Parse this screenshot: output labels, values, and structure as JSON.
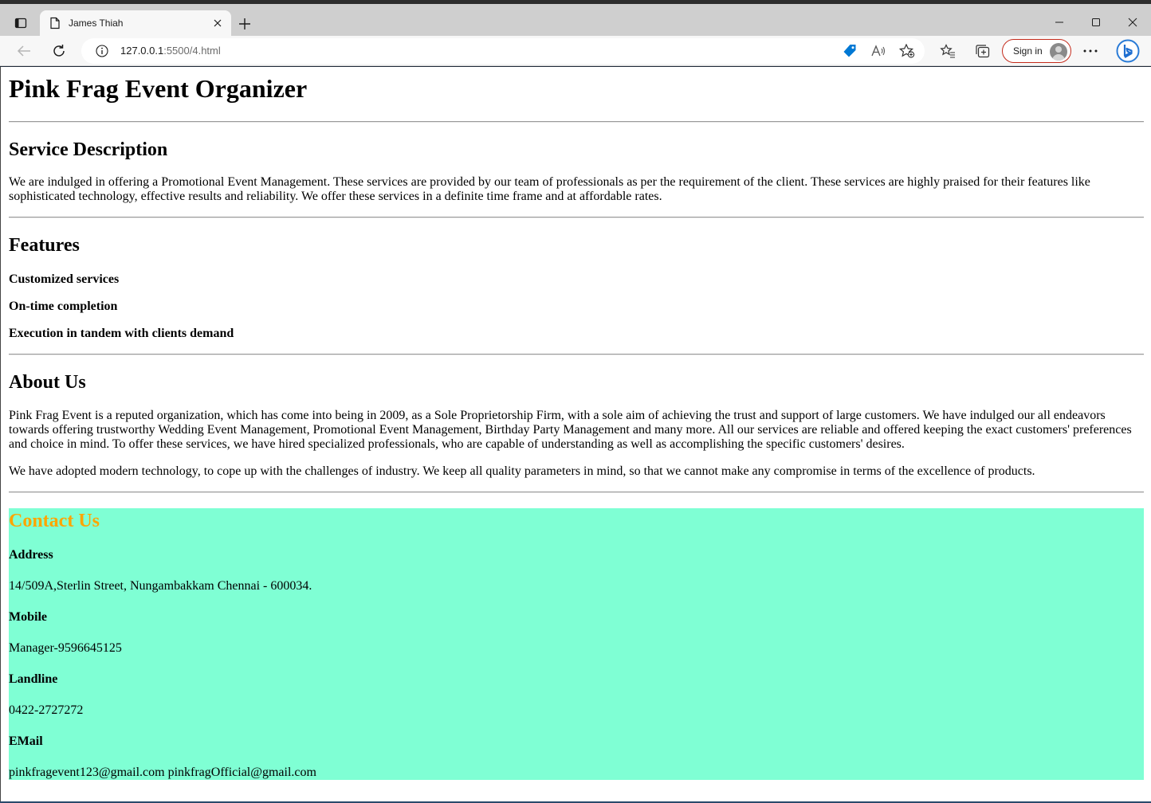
{
  "browser": {
    "tab_title": "James Thiah",
    "url_host": "127.0.0.1",
    "url_path": ":5500/4.html",
    "signin_label": "Sign in",
    "colors": {
      "accent": "#0078d4",
      "signin_border": "#c42b1c"
    }
  },
  "page": {
    "title": "Pink Frag Event Organizer",
    "service": {
      "heading": "Service Description",
      "text": "We are indulged in offering a Promotional Event Management. These services are provided by our team of professionals as per the requirement of the client. These services are highly praised for their features like sophisticated technology, effective results and reliability. We offer these services in a definite time frame and at affordable rates."
    },
    "features": {
      "heading": "Features",
      "items": [
        "Customized services",
        "On-time completion",
        "Execution in tandem with clients demand"
      ]
    },
    "about": {
      "heading": "About Us",
      "p1": "Pink Frag Event is a reputed organization, which has come into being in 2009, as a Sole Proprietorship Firm, with a sole aim of achieving the trust and support of large customers. We have indulged our all endeavors towards offering trustworthy Wedding Event Management, Promotional Event Management, Birthday Party Management and many more. All our services are reliable and offered keeping the exact customers' preferences and choice in mind. To offer these services, we have hired specialized professionals, who are capable of understanding as well as accomplishing the specific customers' desires.",
      "p2": "We have adopted modern technology, to cope up with the challenges of industry. We keep all quality parameters in mind, so that we cannot make any compromise in terms of the excellence of products."
    },
    "contact": {
      "heading": "Contact Us",
      "address_label": "Address",
      "address": "14/509A,Sterlin Street, Nungambakkam Chennai - 600034.",
      "mobile_label": "Mobile",
      "mobile": "Manager-9596645125",
      "landline_label": "Landline",
      "landline": "0422-2727272",
      "email_label": "EMail",
      "email": "pinkfragevent123@gmail.com pinkfragOfficial@gmail.com",
      "colors": {
        "background": "#7fffd4",
        "heading": "#ffa500"
      }
    }
  }
}
